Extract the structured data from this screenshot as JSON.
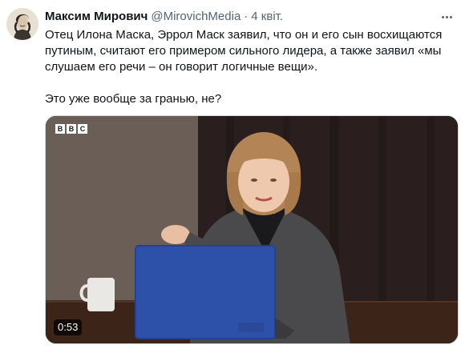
{
  "author": {
    "name": "Максим Мирович",
    "handle": "@MirovichMedia",
    "separator": "·",
    "date": "4 квіт."
  },
  "tweet": {
    "line1": "Отец Илона Маска, Эррол Маск заявил, что он и его сын восхищаются",
    "line2": "путиным, считают его примером сильного лидера, а также заявил «мы",
    "line3": "слушаем его речи – он говорит логичные вещи».",
    "line4": "Это уже вообще за гранью, не?"
  },
  "media": {
    "logo_letters": [
      "B",
      "B",
      "C"
    ],
    "duration": "0:53"
  },
  "icons": {
    "more": "more-horizontal-icon",
    "avatar": "avatar-portrait"
  },
  "colors": {
    "text": "#0f1419",
    "secondary": "#536471",
    "laptop": "#2d50a8",
    "jacket": "#4a4a4c"
  }
}
